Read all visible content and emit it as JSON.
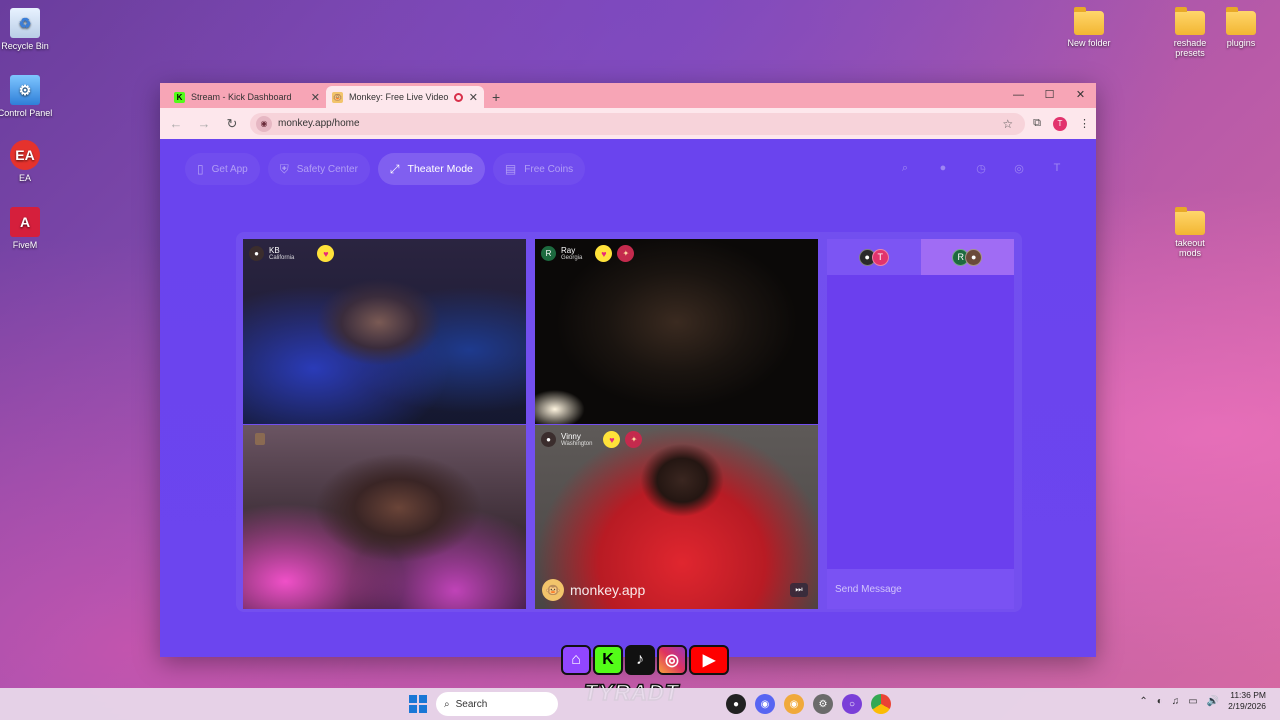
{
  "desktop": {
    "left_icons": [
      {
        "label": "Recycle Bin",
        "icon": "recycle-bin-icon"
      },
      {
        "label": "Control Panel",
        "icon": "control-panel-icon"
      },
      {
        "label": "EA",
        "icon": "ea-icon"
      },
      {
        "label": "FiveM",
        "icon": "fivem-icon"
      }
    ],
    "right_icons": [
      {
        "label": "New folder",
        "icon": "folder-icon"
      },
      {
        "label": "reshade presets",
        "icon": "folder-icon"
      },
      {
        "label": "plugins",
        "icon": "folder-icon"
      },
      {
        "label": "takeout mods",
        "icon": "folder-icon"
      }
    ]
  },
  "browser": {
    "tabs": [
      {
        "title": "Stream - Kick Dashboard",
        "favicon": "K",
        "active": false
      },
      {
        "title": "Monkey: Free Live Video Ch",
        "favicon": "monkey-icon",
        "active": true
      }
    ],
    "url": "monkey.app/home"
  },
  "monkey": {
    "nav": {
      "get_app": "Get App",
      "safety": "Safety Center",
      "theater": "Theater Mode",
      "coins": "Free Coins"
    },
    "tiles": {
      "kb": {
        "name": "KB",
        "location": "California"
      },
      "ray": {
        "name": "Ray",
        "location": "Georgia",
        "initial": "R"
      },
      "vinny": {
        "name": "Vinny",
        "location": "Washington"
      }
    },
    "watermark": "monkey.app",
    "chat": {
      "tab1_initial": "T",
      "tab2_initial": "R",
      "send_placeholder": "Send Message"
    },
    "profile_initial": "T"
  },
  "overlay": {
    "brand": "TYRADT"
  },
  "taskbar": {
    "search_label": "Search",
    "time": "11:36 PM",
    "date": "2/19/2026"
  },
  "colors": {
    "page_bg": "#6a44ee",
    "tab_bar": "#f7a5b6",
    "accent_heart": "#ffe23a"
  }
}
